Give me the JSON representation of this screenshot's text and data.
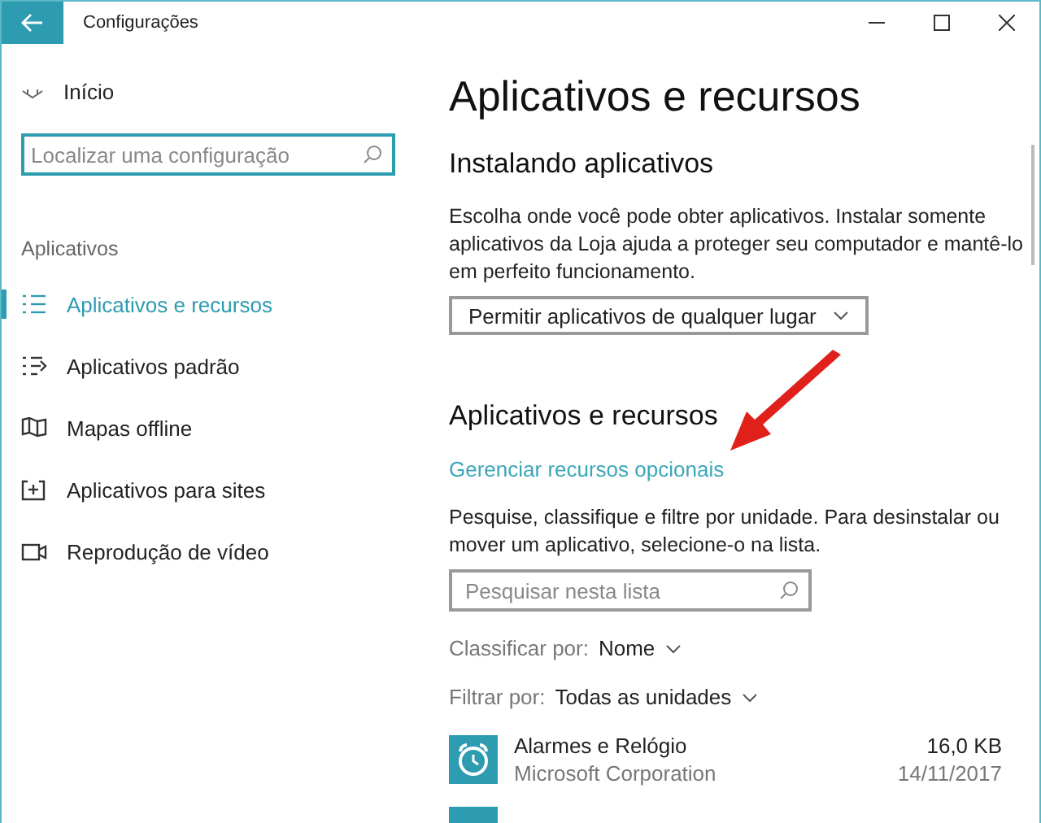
{
  "window": {
    "title": "Configurações"
  },
  "sidebar": {
    "home": "Início",
    "search": {
      "placeholder": "Localizar uma configuração"
    },
    "section": "Aplicativos",
    "items": [
      {
        "label": "Aplicativos e recursos",
        "selected": true
      },
      {
        "label": "Aplicativos padrão",
        "selected": false
      },
      {
        "label": "Mapas offline",
        "selected": false
      },
      {
        "label": "Aplicativos para sites",
        "selected": false
      },
      {
        "label": "Reprodução de vídeo",
        "selected": false
      }
    ]
  },
  "main": {
    "title": "Aplicativos e recursos",
    "installing": {
      "heading": "Instalando aplicativos",
      "description": "Escolha onde você pode obter aplicativos. Instalar somente aplicativos da Loja ajuda a proteger seu computador e mantê-lo em perfeito funcionamento.",
      "dropdown": "Permitir aplicativos de qualquer lugar"
    },
    "apps": {
      "heading": "Aplicativos e recursos",
      "link": "Gerenciar recursos opcionais",
      "description": "Pesquise, classifique e filtre por unidade. Para desinstalar ou mover um aplicativo, selecione-o na lista.",
      "search": {
        "placeholder": "Pesquisar nesta lista"
      },
      "sort": {
        "label": "Classificar por:",
        "value": "Nome"
      },
      "filter": {
        "label": "Filtrar por:",
        "value": "Todas as unidades"
      },
      "list": [
        {
          "name": "Alarmes e Relógio",
          "publisher": "Microsoft Corporation",
          "size": "16,0 KB",
          "date": "14/11/2017"
        }
      ]
    }
  }
}
